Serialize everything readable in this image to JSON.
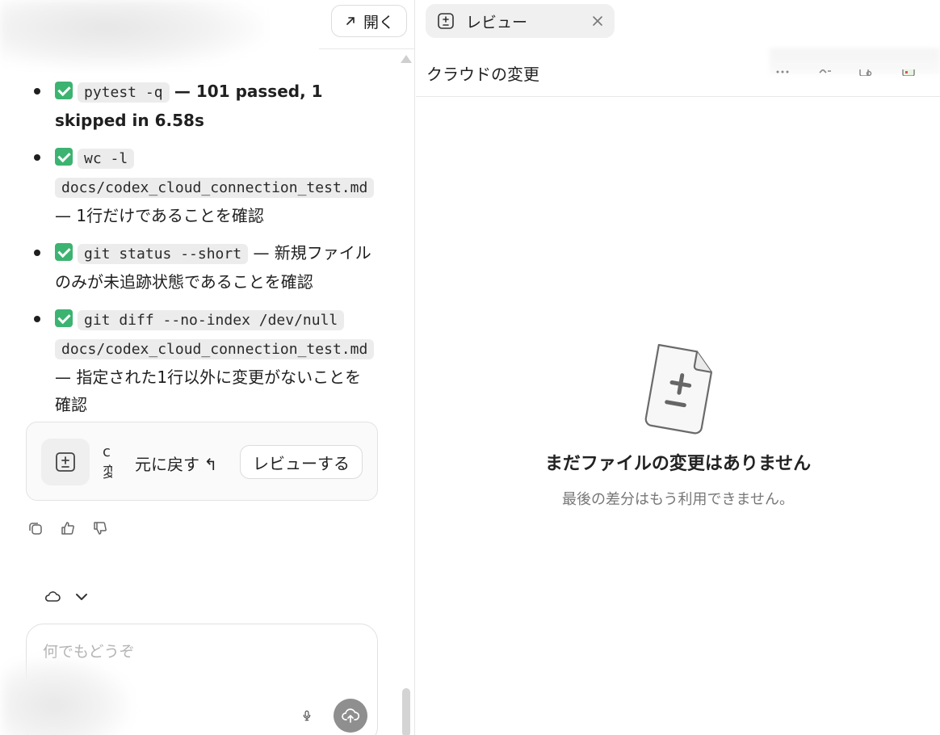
{
  "left_pane": {
    "open_button_label": "開く",
    "checks": [
      {
        "command": "pytest -q",
        "result": "— 101 passed, 1 skipped in 6.58s"
      },
      {
        "command_line1": "wc -l",
        "command_line2": "docs/codex_cloud_connection_test.md",
        "result": "— 1行だけであることを確認"
      },
      {
        "command": "git status --short",
        "result": "— 新規ファイルのみが未追跡状態であることを確認"
      },
      {
        "command_line1": "git diff --no-index /dev/null",
        "command_line2": "docs/codex_cloud_connection_test.md",
        "result": "— 指定された1行以外に変更がないことを確認"
      }
    ],
    "review_card": {
      "clipped_text": "c 変",
      "revert_label": "元に戻す ↰",
      "review_label": "レビューする"
    },
    "composer": {
      "placeholder": "何でもどうぞ"
    }
  },
  "right_pane": {
    "tab_label": "レビュー",
    "header_title": "クラウドの変更",
    "empty_state": {
      "title": "まだファイルの変更はありません",
      "subtitle": "最後の差分はもう利用できません。"
    }
  },
  "colors": {
    "check_green": "#3cb371",
    "send_button": "#8f8f8f",
    "tab_bg": "#f0f0f0"
  }
}
